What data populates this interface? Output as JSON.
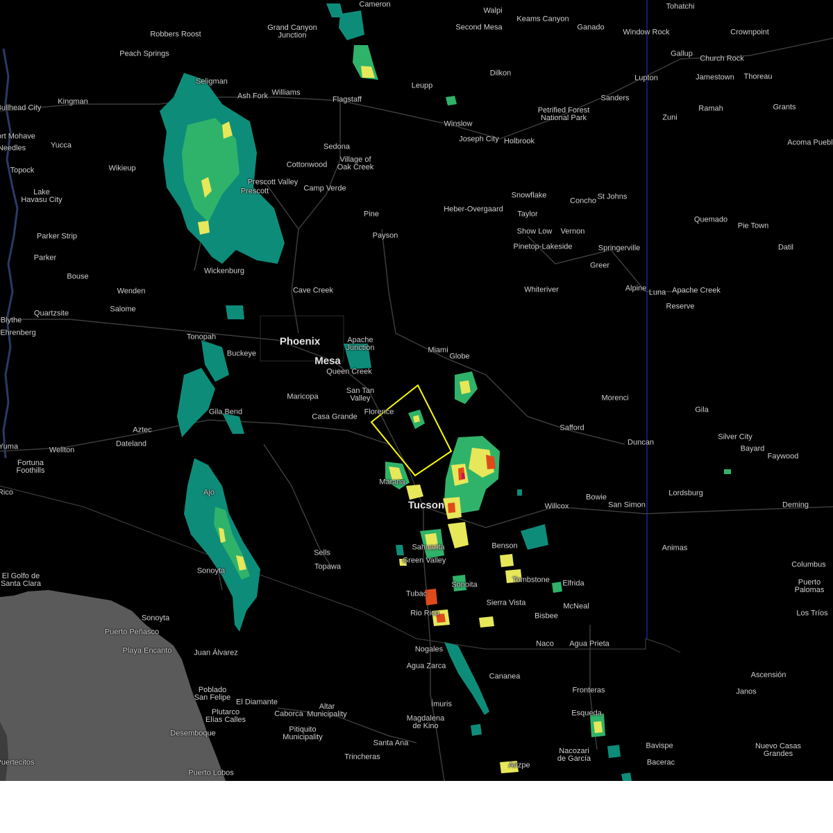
{
  "map": {
    "style": "dark-radar",
    "colors": {
      "background": "#000000",
      "land_mexico_coast": "#5a5a5a",
      "roads": "#3a3a3a",
      "state_border": "#1a1a9a",
      "warning_polygon": "#ffff00",
      "radar_light": "#0e8c7a",
      "radar_mid": "#2fb36a",
      "radar_heavy": "#e7e75a",
      "radar_intense": "#e04a1a",
      "radar_extreme": "#d01060",
      "label_text": "#cfcfcf"
    },
    "places": [
      {
        "id": "cameron",
        "name": "Cameron"
      },
      {
        "id": "tohatchi",
        "name": "Tohatchi"
      },
      {
        "id": "walpi",
        "name": "Walpi"
      },
      {
        "id": "keams",
        "name": "Keams Canyon"
      },
      {
        "id": "robbers",
        "name": "Robbers Roost"
      },
      {
        "id": "grandcanyon",
        "name": "Grand Canyon\nJunction"
      },
      {
        "id": "secondmesa",
        "name": "Second Mesa"
      },
      {
        "id": "ganado",
        "name": "Ganado"
      },
      {
        "id": "windowrock",
        "name": "Window Rock"
      },
      {
        "id": "crownpoint",
        "name": "Crownpoint"
      },
      {
        "id": "peachsprings",
        "name": "Peach Springs"
      },
      {
        "id": "gallup",
        "name": "Gallup"
      },
      {
        "id": "churchrock",
        "name": "Church Rock"
      },
      {
        "id": "dilkon",
        "name": "Dilkon"
      },
      {
        "id": "seligman",
        "name": "Seligman"
      },
      {
        "id": "jamestown",
        "name": "Jamestown"
      },
      {
        "id": "thoreau",
        "name": "Thoreau"
      },
      {
        "id": "lupton",
        "name": "Lupton"
      },
      {
        "id": "leupp",
        "name": "Leupp"
      },
      {
        "id": "ashfork",
        "name": "Ash Fork"
      },
      {
        "id": "williams",
        "name": "Williams"
      },
      {
        "id": "kingman",
        "name": "Kingman"
      },
      {
        "id": "flagstaff",
        "name": "Flagstaff"
      },
      {
        "id": "sanders",
        "name": "Sanders"
      },
      {
        "id": "bullhead",
        "name": "Bullhead City"
      },
      {
        "id": "ramah",
        "name": "Ramah"
      },
      {
        "id": "grants",
        "name": "Grants"
      },
      {
        "id": "petrified",
        "name": "Petrified Forest\nNational Park"
      },
      {
        "id": "zuni",
        "name": "Zuni"
      },
      {
        "id": "winslow",
        "name": "Winslow"
      },
      {
        "id": "fortmohave",
        "name": "Fort Mohave"
      },
      {
        "id": "josephcity",
        "name": "Joseph City"
      },
      {
        "id": "holbrook",
        "name": "Holbrook"
      },
      {
        "id": "acoma",
        "name": "Acoma Pueblo"
      },
      {
        "id": "needles",
        "name": "Needles"
      },
      {
        "id": "yucca",
        "name": "Yucca"
      },
      {
        "id": "sedona",
        "name": "Sedona"
      },
      {
        "id": "villageoak",
        "name": "Village of\nOak Creek"
      },
      {
        "id": "cottonwood",
        "name": "Cottonwood"
      },
      {
        "id": "topock",
        "name": "Topock"
      },
      {
        "id": "wikieup",
        "name": "Wikieup"
      },
      {
        "id": "prescottvalley",
        "name": "Prescott Valley"
      },
      {
        "id": "prescott",
        "name": "Prescott"
      },
      {
        "id": "campverde",
        "name": "Camp Verde"
      },
      {
        "id": "havasu",
        "name": "Lake\nHavasu City"
      },
      {
        "id": "snowflake",
        "name": "Snowflake"
      },
      {
        "id": "concho",
        "name": "Concho"
      },
      {
        "id": "stjohns",
        "name": "St Johns"
      },
      {
        "id": "heber",
        "name": "Heber-Overgaard"
      },
      {
        "id": "taylor",
        "name": "Taylor"
      },
      {
        "id": "pine",
        "name": "Pine"
      },
      {
        "id": "quemado",
        "name": "Quemado"
      },
      {
        "id": "pietown",
        "name": "Pie Town"
      },
      {
        "id": "showlow",
        "name": "Show Low"
      },
      {
        "id": "vernon",
        "name": "Vernon"
      },
      {
        "id": "payson",
        "name": "Payson"
      },
      {
        "id": "parkerstrip",
        "name": "Parker Strip"
      },
      {
        "id": "pinetop",
        "name": "Pinetop-Lakeside"
      },
      {
        "id": "springerville",
        "name": "Springerville"
      },
      {
        "id": "datil",
        "name": "Datil"
      },
      {
        "id": "parker",
        "name": "Parker"
      },
      {
        "id": "greer",
        "name": "Greer"
      },
      {
        "id": "wickenburg",
        "name": "Wickenburg"
      },
      {
        "id": "bouse",
        "name": "Bouse"
      },
      {
        "id": "whiteriver",
        "name": "Whiteriver"
      },
      {
        "id": "alpine",
        "name": "Alpine"
      },
      {
        "id": "luna",
        "name": "Luna"
      },
      {
        "id": "apachecreek",
        "name": "Apache Creek"
      },
      {
        "id": "cavecreek",
        "name": "Cave Creek"
      },
      {
        "id": "wenden",
        "name": "Wenden"
      },
      {
        "id": "reserve",
        "name": "Reserve"
      },
      {
        "id": "salome",
        "name": "Salome"
      },
      {
        "id": "quartzsite",
        "name": "Quartzsite"
      },
      {
        "id": "blythe",
        "name": "Blythe"
      },
      {
        "id": "ehrenberg",
        "name": "Ehrenberg"
      },
      {
        "id": "tonopah",
        "name": "Tonopah"
      },
      {
        "id": "phoenix",
        "name": "Phoenix",
        "big": true
      },
      {
        "id": "apachejunction",
        "name": "Apache\nJunction"
      },
      {
        "id": "miami",
        "name": "Miami"
      },
      {
        "id": "globe",
        "name": "Globe"
      },
      {
        "id": "buckeye",
        "name": "Buckeye"
      },
      {
        "id": "mesa",
        "name": "Mesa",
        "big": true
      },
      {
        "id": "queencreek",
        "name": "Queen Creek"
      },
      {
        "id": "santan",
        "name": "San Tan\nValley"
      },
      {
        "id": "maricopa",
        "name": "Maricopa"
      },
      {
        "id": "morenci",
        "name": "Morenci"
      },
      {
        "id": "florence",
        "name": "Florence"
      },
      {
        "id": "casagrande",
        "name": "Casa Grande"
      },
      {
        "id": "gilabend",
        "name": "Gila Bend"
      },
      {
        "id": "gila",
        "name": "Gila"
      },
      {
        "id": "safford",
        "name": "Safford"
      },
      {
        "id": "aztec",
        "name": "Aztec"
      },
      {
        "id": "silvercity",
        "name": "Silver City"
      },
      {
        "id": "duncan",
        "name": "Duncan"
      },
      {
        "id": "dateland",
        "name": "Dateland"
      },
      {
        "id": "bayard",
        "name": "Bayard"
      },
      {
        "id": "yuma",
        "name": "Yuma"
      },
      {
        "id": "wellton",
        "name": "Wellton"
      },
      {
        "id": "faywood",
        "name": "Faywood"
      },
      {
        "id": "fortuna",
        "name": "Fortuna\nFoothills"
      },
      {
        "id": "marana",
        "name": "Marana"
      },
      {
        "id": "rico",
        "name": "Rico"
      },
      {
        "id": "lordsburg",
        "name": "Lordsburg"
      },
      {
        "id": "ajo",
        "name": "Ajo"
      },
      {
        "id": "bowie",
        "name": "Bowie"
      },
      {
        "id": "tucson",
        "name": "Tucson",
        "big": true
      },
      {
        "id": "sansimon",
        "name": "San Simon"
      },
      {
        "id": "deming",
        "name": "Deming"
      },
      {
        "id": "willcox",
        "name": "Willcox"
      },
      {
        "id": "sahuarita",
        "name": "Sahuarita"
      },
      {
        "id": "benson",
        "name": "Benson"
      },
      {
        "id": "animas",
        "name": "Animas"
      },
      {
        "id": "sells",
        "name": "Sells"
      },
      {
        "id": "greenvalley",
        "name": "Green Valley"
      },
      {
        "id": "topawa",
        "name": "Topawa"
      },
      {
        "id": "columbus",
        "name": "Columbus"
      },
      {
        "id": "sonoita",
        "name": "Sonoita"
      },
      {
        "id": "elgolfo",
        "name": "El Golfo de\nSanta Clara"
      },
      {
        "id": "tombstone",
        "name": "Tombstone"
      },
      {
        "id": "elfrida",
        "name": "Elfrida"
      },
      {
        "id": "puertopalomas",
        "name": "Puerto\nPalomas"
      },
      {
        "id": "sonoyta",
        "name": "Sonoyta"
      },
      {
        "id": "tubac",
        "name": "Tubac"
      },
      {
        "id": "sierravista",
        "name": "Sierra Vista"
      },
      {
        "id": "mcneal",
        "name": "McNeal"
      },
      {
        "id": "riorico",
        "name": "Rio Rico"
      },
      {
        "id": "lostrios",
        "name": "Los Tríos"
      },
      {
        "id": "bisbee",
        "name": "Bisbee"
      },
      {
        "id": "sonoyta2",
        "name": "Sonoyta"
      },
      {
        "id": "puertopenasco",
        "name": "Puerto Peñasco"
      },
      {
        "id": "naco",
        "name": "Naco"
      },
      {
        "id": "aguaprieta",
        "name": "Agua Prieta"
      },
      {
        "id": "playaencanto",
        "name": "Playa Encanto"
      },
      {
        "id": "nogales",
        "name": "Nogales"
      },
      {
        "id": "juanalvarez",
        "name": "Juan Álvarez"
      },
      {
        "id": "aguazarca",
        "name": "Agua Zarca"
      },
      {
        "id": "cananea",
        "name": "Cananea"
      },
      {
        "id": "ascension",
        "name": "Ascensión"
      },
      {
        "id": "janos",
        "name": "Janos"
      },
      {
        "id": "fronteras",
        "name": "Fronteras"
      },
      {
        "id": "poblado",
        "name": "Poblado\nSan Felipe"
      },
      {
        "id": "eldiamante",
        "name": "El Diamante"
      },
      {
        "id": "imuris",
        "name": "Ímuris"
      },
      {
        "id": "plutarco",
        "name": "Plutarco\nElías Calles"
      },
      {
        "id": "caborca",
        "name": "Caborca"
      },
      {
        "id": "altar",
        "name": "Altar\nMunicipality"
      },
      {
        "id": "esqueda",
        "name": "Esqueda"
      },
      {
        "id": "magdalena",
        "name": "Magdalena\nde Kino"
      },
      {
        "id": "pitiquito",
        "name": "Pitiquito\nMunicipality"
      },
      {
        "id": "desemboque",
        "name": "Desemboque"
      },
      {
        "id": "santaana",
        "name": "Santa Ana"
      },
      {
        "id": "bavispe",
        "name": "Bavispe"
      },
      {
        "id": "nuevocasas",
        "name": "Nuevo Casas\nGrandes"
      },
      {
        "id": "nacozari",
        "name": "Nacozari\nde García"
      },
      {
        "id": "trincheras",
        "name": "Trincheras"
      },
      {
        "id": "bacerac",
        "name": "Bacerac"
      },
      {
        "id": "arizpe",
        "name": "Arizpe"
      },
      {
        "id": "puertitos",
        "name": "Puertecitos"
      },
      {
        "id": "puertolobos",
        "name": "Puerto Lobos"
      }
    ]
  }
}
